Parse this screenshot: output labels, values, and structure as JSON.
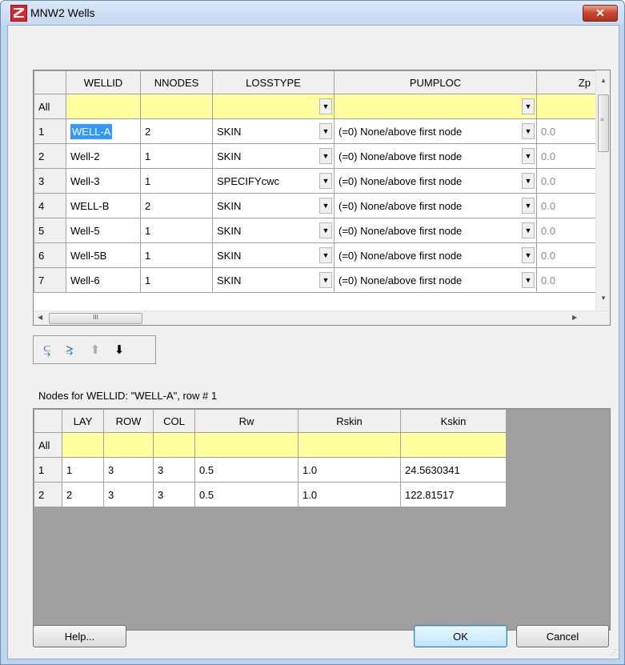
{
  "window": {
    "title": "MNW2 Wells",
    "close_label": "✕"
  },
  "wells_grid": {
    "columns": [
      "WELLID",
      "NNODES",
      "LOSSTYPE",
      "PUMPLOC",
      "Zp"
    ],
    "all_label": "All",
    "rows": [
      {
        "num": "1",
        "wellid": "WELL-A",
        "nnodes": "2",
        "losstype": "SKIN",
        "pumploc": "(=0) None/above first node",
        "zp": "0.0"
      },
      {
        "num": "2",
        "wellid": "Well-2",
        "nnodes": "1",
        "losstype": "SKIN",
        "pumploc": "(=0) None/above first node",
        "zp": "0.0"
      },
      {
        "num": "3",
        "wellid": "Well-3",
        "nnodes": "1",
        "losstype": "SPECIFYcwc",
        "pumploc": "(=0) None/above first node",
        "zp": "0.0"
      },
      {
        "num": "4",
        "wellid": "WELL-B",
        "nnodes": "2",
        "losstype": "SKIN",
        "pumploc": "(=0) None/above first node",
        "zp": "0.0"
      },
      {
        "num": "5",
        "wellid": "Well-5",
        "nnodes": "1",
        "losstype": "SKIN",
        "pumploc": "(=0) None/above first node",
        "zp": "0.0"
      },
      {
        "num": "6",
        "wellid": "Well-5B",
        "nnodes": "1",
        "losstype": "SKIN",
        "pumploc": "(=0) None/above first node",
        "zp": "0.0"
      },
      {
        "num": "7",
        "wellid": "Well-6",
        "nnodes": "1",
        "losstype": "SKIN",
        "pumploc": "(=0) None/above first node",
        "zp": "0.0"
      }
    ],
    "hscroll_thumb": "III"
  },
  "toolbar": {
    "insert_icon": "insert-row-icon",
    "add_icon": "add-row-icon",
    "up_icon": "move-up-icon",
    "down_icon": "move-down-icon"
  },
  "nodes_caption": "Nodes for WELLID: \"WELL-A\", row # 1",
  "nodes_grid": {
    "columns": [
      "LAY",
      "ROW",
      "COL",
      "Rw",
      "Rskin",
      "Kskin"
    ],
    "all_label": "All",
    "rows": [
      {
        "num": "1",
        "lay": "1",
        "row": "3",
        "col": "3",
        "rw": "0.5",
        "rskin": "1.0",
        "kskin": "24.5630341"
      },
      {
        "num": "2",
        "lay": "2",
        "row": "3",
        "col": "3",
        "rw": "0.5",
        "rskin": "1.0",
        "kskin": "122.81517"
      }
    ]
  },
  "buttons": {
    "help": "Help...",
    "ok": "OK",
    "cancel": "Cancel"
  },
  "colors": {
    "all_row": "#ffffa0",
    "selection": "#3399ff",
    "grid_bg": "#a0a0a0"
  }
}
